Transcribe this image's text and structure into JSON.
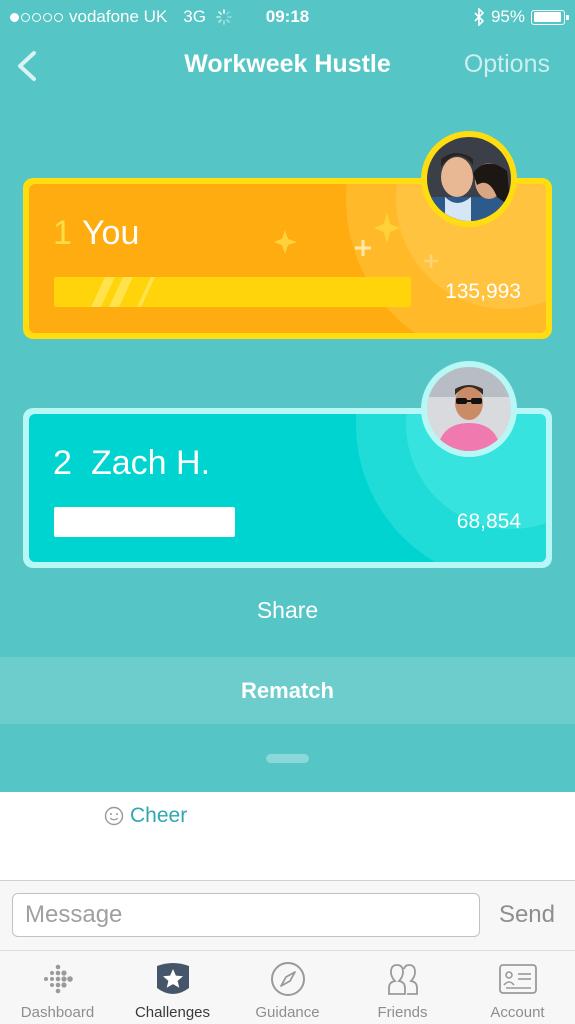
{
  "status_bar": {
    "carrier": "vodafone UK",
    "network": "3G",
    "time": "09:18",
    "battery": "95%",
    "battery_level": 0.95,
    "signal_bars": 1,
    "icons": [
      "signal-dots-icon",
      "loading-spinner-icon",
      "bluetooth-icon",
      "battery-icon"
    ]
  },
  "nav": {
    "back_icon": "chevron-left-icon",
    "title": "Workweek Hustle",
    "options_label": "Options"
  },
  "leaderboard": [
    {
      "rank": "1",
      "name": "You",
      "steps": "135,993",
      "progress": 1.0,
      "avatar": "avatar-couple-photo"
    },
    {
      "rank": "2",
      "name": "Zach H.",
      "steps": "68,854",
      "progress": 0.506,
      "avatar": "avatar-man-sunglasses-photo"
    }
  ],
  "actions": {
    "share_label": "Share",
    "rematch_label": "Rematch"
  },
  "feed": {
    "cheer_label": "Cheer",
    "cheer_icon": "smiley-icon"
  },
  "composer": {
    "message_placeholder": "Message",
    "message_value": "",
    "send_label": "Send"
  },
  "tabbar": {
    "active": "Challenges",
    "tabs": [
      {
        "label": "Dashboard",
        "icon": "dashboard-dots-icon"
      },
      {
        "label": "Challenges",
        "icon": "star-badge-icon"
      },
      {
        "label": "Guidance",
        "icon": "compass-icon"
      },
      {
        "label": "Friends",
        "icon": "friends-icon"
      },
      {
        "label": "Account",
        "icon": "account-card-icon"
      }
    ]
  },
  "colors": {
    "panel": "#55c5c5",
    "gold": "#ffac10",
    "gold_border": "#ffdd10",
    "teal_card": "#00d4d1",
    "teal_border": "#b7f7f5",
    "link": "#2fa7b3"
  }
}
